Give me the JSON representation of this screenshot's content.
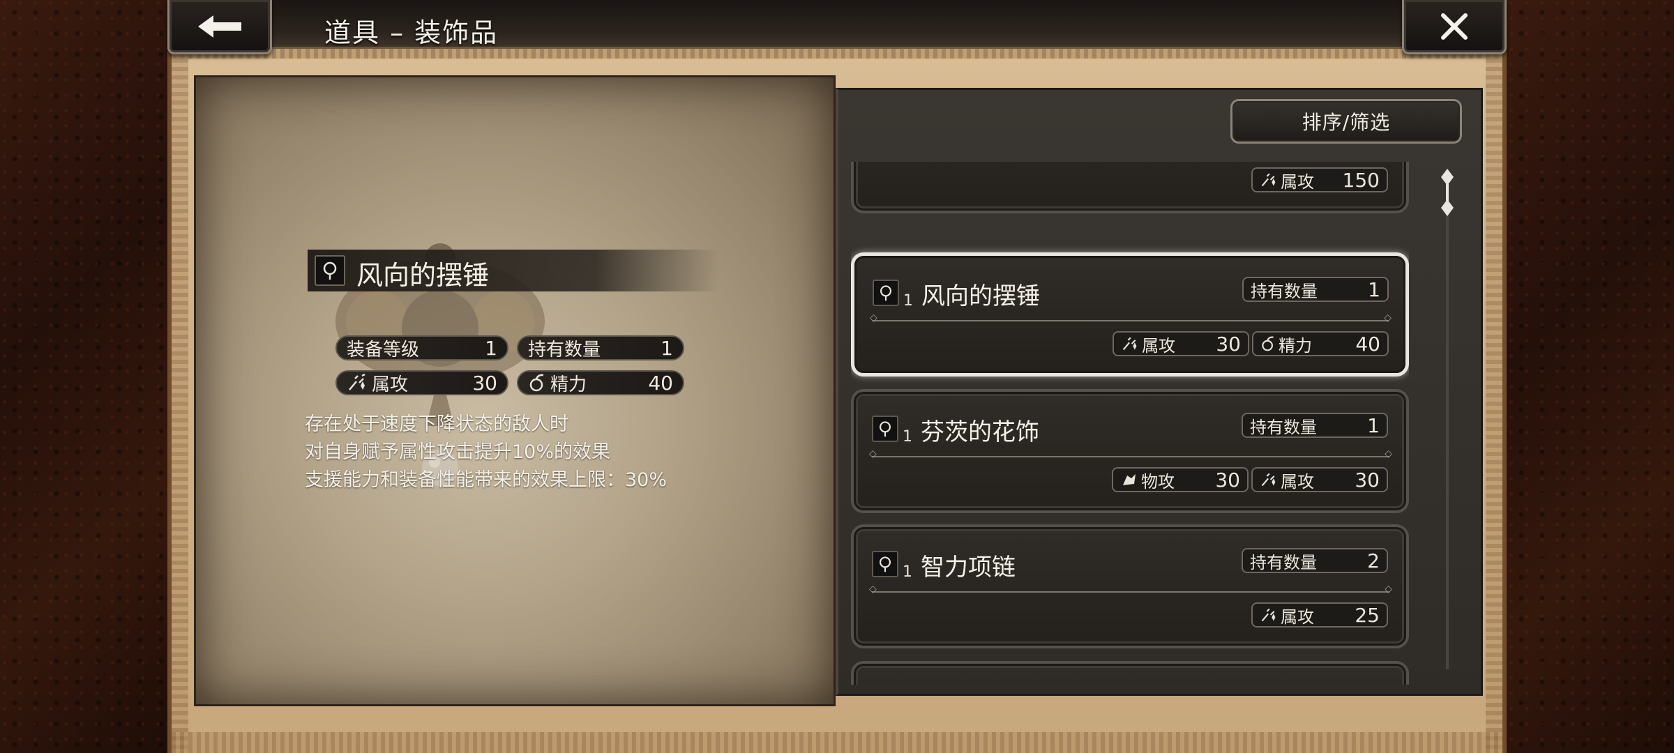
{
  "header": {
    "title": "道具 – 装饰品",
    "back_icon": "back-arrow-icon",
    "close_icon": "close-icon"
  },
  "detail": {
    "name": "风向的摆锤",
    "icon": "accessory-pendant-icon",
    "equip_level_label": "装备等级",
    "equip_level_value": "1",
    "owned_label": "持有数量",
    "owned_value": "1",
    "stat1_label": "属攻",
    "stat1_icon": "elemental-attack-icon",
    "stat1_value": "30",
    "stat2_label": "精力",
    "stat2_icon": "stamina-icon",
    "stat2_value": "40",
    "description": [
      "存在处于速度下降状态的敌人时",
      "对自身赋予属性攻击提升10%的效果",
      "支援能力和装备性能带来的效果上限：30%"
    ]
  },
  "list": {
    "sort_button": "排序/筛选",
    "owned_label": "持有数量",
    "partial_top_card": {
      "stat_label": "属攻",
      "stat_value": "150"
    },
    "items": [
      {
        "level": "1",
        "name": "风向的摆锤",
        "owned": "1",
        "selected": true,
        "stats": [
          {
            "label": "属攻",
            "value": "30",
            "icon": "elemental-attack-icon"
          },
          {
            "label": "精力",
            "value": "40",
            "icon": "stamina-icon"
          }
        ]
      },
      {
        "level": "1",
        "name": "芬茨的花饰",
        "owned": "1",
        "selected": false,
        "stats": [
          {
            "label": "物攻",
            "value": "30",
            "icon": "physical-attack-icon"
          },
          {
            "label": "属攻",
            "value": "30",
            "icon": "elemental-attack-icon"
          }
        ]
      },
      {
        "level": "1",
        "name": "智力项链",
        "owned": "2",
        "selected": false,
        "stats": [
          {
            "label": "属攻",
            "value": "25",
            "icon": "elemental-attack-icon"
          }
        ]
      }
    ]
  },
  "colors": {
    "parchment": "#b3a48a",
    "panel_dark": "#2f2b27",
    "selected_border": "#e9e6df",
    "frame_brown": "#cfb088"
  }
}
